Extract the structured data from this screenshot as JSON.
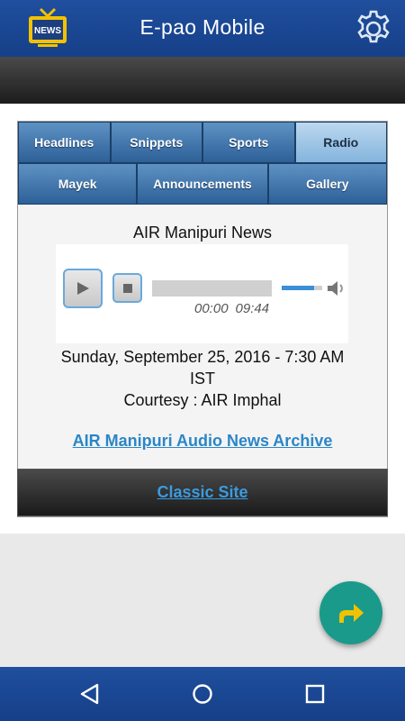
{
  "app": {
    "title": "E-pao Mobile",
    "logo_text": "NEWS",
    "colors": {
      "appbar": "#1f4f9e",
      "tab": "#2c6098",
      "tab_active": "#84b4dd",
      "link": "#2b86c6",
      "fab": "#1a9a8a"
    }
  },
  "tabs": {
    "row1": [
      {
        "label": "Headlines",
        "active": false
      },
      {
        "label": "Snippets",
        "active": false
      },
      {
        "label": "Sports",
        "active": false
      },
      {
        "label": "Radio",
        "active": true
      }
    ],
    "row2": [
      {
        "label": "Mayek",
        "active": false
      },
      {
        "label": "Announcements",
        "active": false
      },
      {
        "label": "Gallery",
        "active": false
      }
    ]
  },
  "radio": {
    "title": "AIR Manipuri News",
    "player": {
      "current_time": "00:00",
      "duration": "09:44",
      "play_icon": "play-icon",
      "stop_icon": "stop-icon",
      "volume_fraction": 0.8
    },
    "date_line1": "Sunday, September 25, 2016 - 7:30 AM",
    "date_line2": "IST",
    "courtesy": "Courtesy : AIR Imphal",
    "archive_link": "AIR Manipuri Audio News Archive"
  },
  "footer": {
    "classic_link": "Classic Site"
  },
  "fab": {
    "icon": "share-arrow-icon"
  },
  "navbar": {
    "back_icon": "back-icon",
    "home_icon": "home-icon",
    "recents_icon": "recents-icon"
  }
}
